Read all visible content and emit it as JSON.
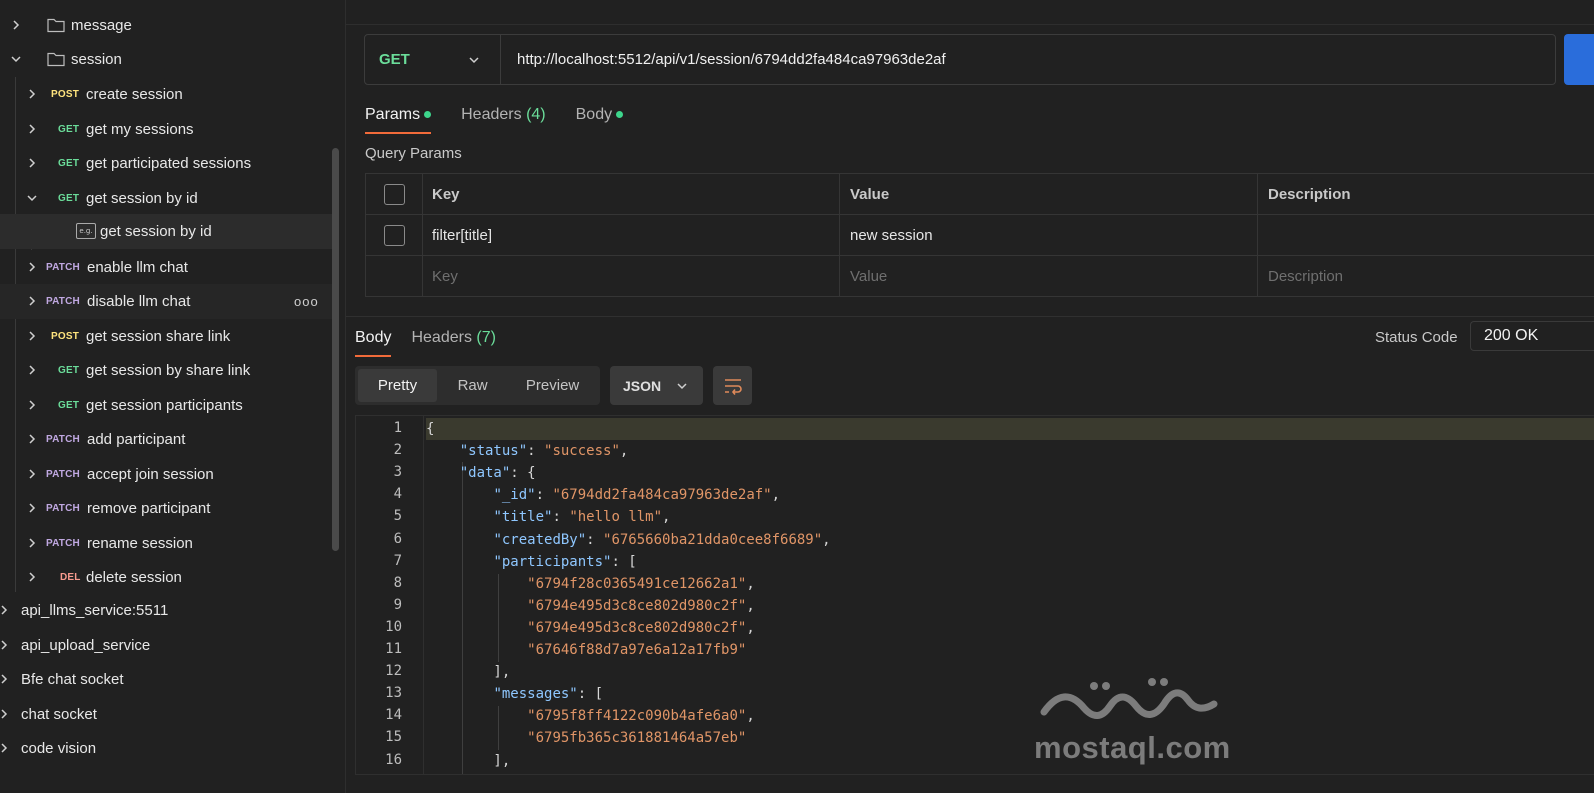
{
  "sidebar": {
    "folders": [
      {
        "label": "message",
        "expanded": false
      },
      {
        "label": "session",
        "expanded": true
      }
    ],
    "requests": [
      {
        "method": "POST",
        "label": "create session",
        "expanded": false
      },
      {
        "method": "GET",
        "label": "get my sessions",
        "expanded": false
      },
      {
        "method": "GET",
        "label": "get participated sessions",
        "expanded": false
      },
      {
        "method": "GET",
        "label": "get session by id",
        "expanded": true
      },
      {
        "method": "PATCH",
        "label": "enable llm chat",
        "expanded": false
      },
      {
        "method": "PATCH",
        "label": "disable llm chat",
        "expanded": false
      },
      {
        "method": "POST",
        "label": "get session share link",
        "expanded": false
      },
      {
        "method": "GET",
        "label": "get session by share link",
        "expanded": false
      },
      {
        "method": "GET",
        "label": "get session participants",
        "expanded": false
      },
      {
        "method": "PATCH",
        "label": "add participant",
        "expanded": false
      },
      {
        "method": "PATCH",
        "label": "accept join session",
        "expanded": false
      },
      {
        "method": "PATCH",
        "label": "remove participant",
        "expanded": false
      },
      {
        "method": "PATCH",
        "label": "rename session",
        "expanded": false
      },
      {
        "method": "DEL",
        "label": "delete session",
        "expanded": false
      }
    ],
    "example": {
      "icon_text": "e.g.",
      "label": "get session by id"
    },
    "collections": [
      {
        "label": "api_llms_service:5511"
      },
      {
        "label": "api_upload_service"
      },
      {
        "label": "Bfe chat socket"
      },
      {
        "label": "chat socket"
      },
      {
        "label": "code vision"
      }
    ],
    "more_icon": "ooo"
  },
  "request": {
    "method": "GET",
    "url": "http://localhost:5512/api/v1/session/6794dd2fa484ca97963de2af",
    "tabs": {
      "params": "Params",
      "headers": "Headers",
      "headers_count": "(4)",
      "body": "Body"
    },
    "query_params_title": "Query Params",
    "table": {
      "headers": {
        "key": "Key",
        "value": "Value",
        "description": "Description"
      },
      "rows": [
        {
          "key": "filter[title]",
          "value": "new session",
          "description": ""
        }
      ],
      "placeholders": {
        "key": "Key",
        "value": "Value",
        "description": "Description"
      }
    }
  },
  "response": {
    "tabs": {
      "body": "Body",
      "headers": "Headers",
      "headers_count": "(7)"
    },
    "status_label": "Status Code",
    "status_value": "200 OK",
    "view_modes": [
      "Pretty",
      "Raw",
      "Preview"
    ],
    "active_view": "Pretty",
    "format": "JSON",
    "lines": [
      "{",
      "    \"status\": \"success\",",
      "    \"data\": {",
      "        \"_id\": \"6794dd2fa484ca97963de2af\",",
      "        \"title\": \"hello llm\",",
      "        \"createdBy\": \"6765660ba21dda0cee8f6689\",",
      "        \"participants\": [",
      "            \"6794f28c0365491ce12662a1\",",
      "            \"6794e495d3c8ce802d980c2f\",",
      "            \"6794e495d3c8ce802d980c2f\",",
      "            \"67646f88d7a97e6a12a17fb9\"",
      "        ],",
      "        \"messages\": [",
      "            \"6795f8ff4122c090b4afe6a0\",",
      "            \"6795fb365c361881464a57eb\"",
      "        ],"
    ]
  },
  "watermark": {
    "arabic": "مستقل",
    "latin": "mostaql.com"
  },
  "colors": {
    "accent": "#f26b3a",
    "get": "#6bdd9a",
    "post": "#ffe47e",
    "patch": "#c0a8e1",
    "delete": "#f79a8e",
    "json_key": "#8fc7ff",
    "json_string": "#e09567"
  }
}
